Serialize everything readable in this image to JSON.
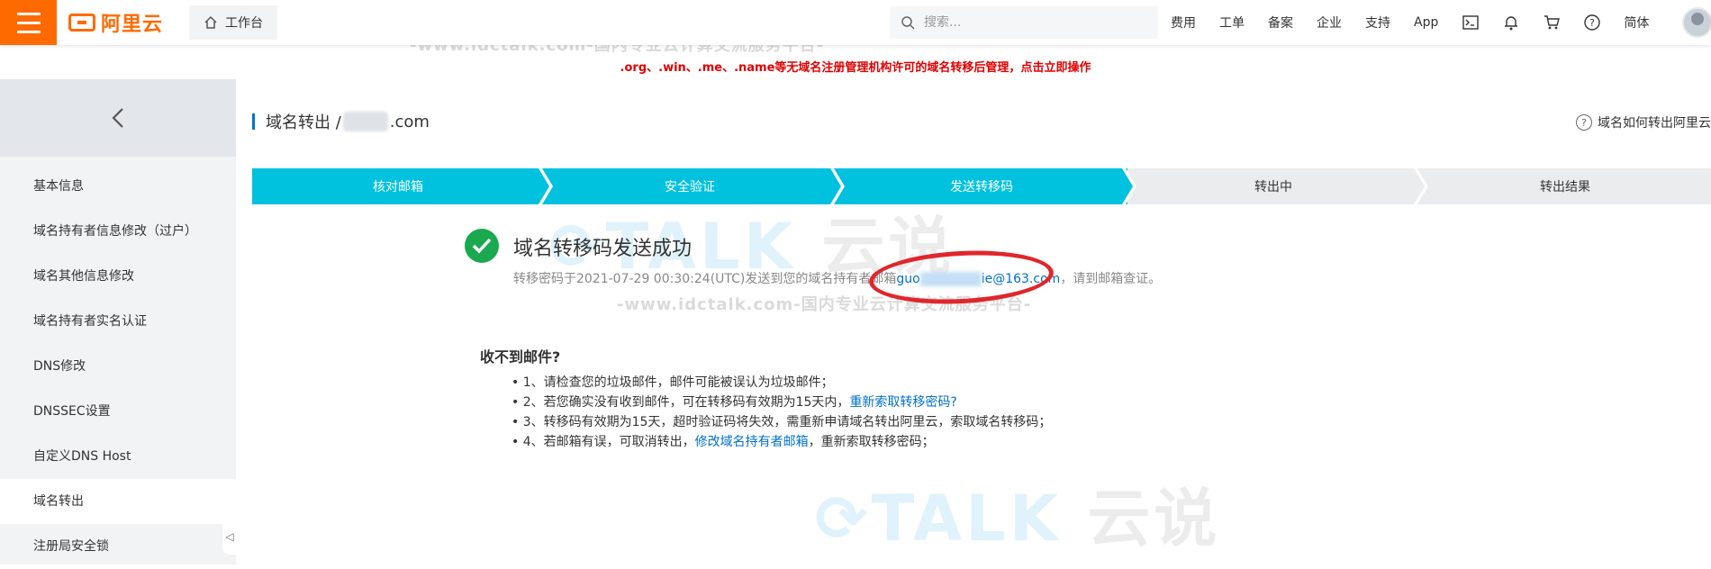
{
  "topbar": {
    "brand": "阿里云",
    "workbench_label": "工作台",
    "search_placeholder": "搜索...",
    "nav": [
      "费用",
      "工单",
      "备案",
      "企业",
      "支持",
      "App"
    ],
    "lang_label": "简体",
    "brand_color": "#ff6a00"
  },
  "watermark": {
    "url_text": "-www.idctalk.com-国内专业云计算交流服务平台-",
    "logo_letters": "TALK",
    "logo_cn": "云说"
  },
  "announcement": {
    "text": ".org、.win、.me、.name等无域名注册管理机构许可的域名转移后管理，",
    "action": "点击立即操作"
  },
  "sidebar": {
    "items": [
      {
        "label": "基本信息"
      },
      {
        "label": "域名持有者信息修改（过户）"
      },
      {
        "label": "域名其他信息修改"
      },
      {
        "label": "域名持有者实名认证"
      },
      {
        "label": "DNS修改"
      },
      {
        "label": "DNSSEC设置"
      },
      {
        "label": "自定义DNS Host"
      },
      {
        "label": "域名转出",
        "active": true
      },
      {
        "label": "注册局安全锁"
      }
    ]
  },
  "main": {
    "breadcrumb_prefix": "域名转出 /",
    "breadcrumb_suffix": ".com",
    "help_link": "域名如何转出阿里云",
    "steps": [
      {
        "label": "核对邮箱",
        "status": "done"
      },
      {
        "label": "安全验证",
        "status": "done"
      },
      {
        "label": "发送转移码",
        "status": "done"
      },
      {
        "label": "转出中",
        "status": "todo"
      },
      {
        "label": "转出结果",
        "status": "todo"
      }
    ],
    "success_title": "域名转移码发送成功",
    "success_desc_prefix": "转移密码于2021-07-29 00:30:24(UTC)发送到您的域名持有者邮箱",
    "email_prefix": "guo",
    "email_suffix": "ie@163.com",
    "success_desc_suffix": "，请到邮箱查证。",
    "faq_title": "收不到邮件?",
    "faq": {
      "item1": "• 1、请检查您的垃圾邮件，邮件可能被误认为垃圾邮件；",
      "item2_prefix": "• 2、若您确实没有收到邮件，可在转移码有效期为15天内，",
      "item2_link": "重新索取转移密码?",
      "item3": "• 3、转移码有效期为15天，超时验证码将失效，需重新申请域名转出阿里云，索取域名转移码；",
      "item4_prefix": "• 4、若邮箱有误，可取消转出，",
      "item4_link": "修改域名持有者邮箱",
      "item4_suffix": "，重新索取转移密码；"
    },
    "colors": {
      "step_done": "#00c1de",
      "step_todo": "#ebeced",
      "success": "#1aa94f",
      "link": "#0070cc",
      "highlight": "#e0262c"
    }
  }
}
